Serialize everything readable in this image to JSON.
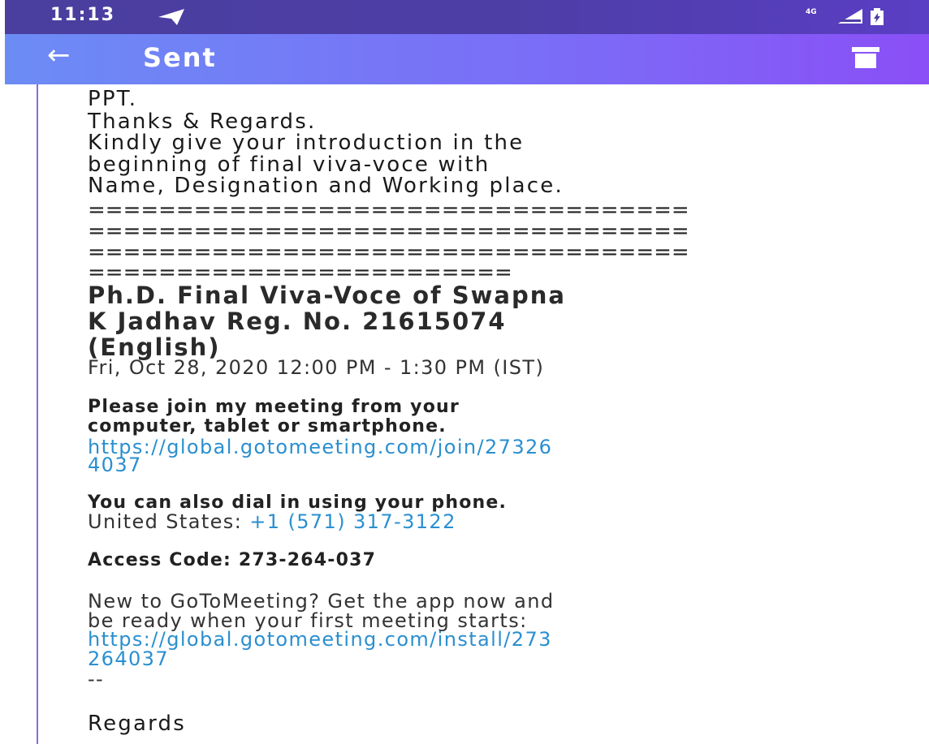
{
  "status_bar": {
    "time": "11:13",
    "network": "4G",
    "icons": [
      "telegram-send-icon",
      "signal-icon",
      "battery-icon"
    ]
  },
  "app_bar": {
    "title": "Sent",
    "icons": [
      "back-arrow-icon",
      "delete-icon"
    ]
  },
  "message": {
    "lines": [
      "PPT.",
      "Thanks & Regards.",
      "Kindly give your introduction in the",
      "beginning of final viva-voce with",
      "Name, Designation and Working place."
    ],
    "separators": [
      "==================================",
      "==================================",
      "==================================",
      "========================"
    ],
    "meeting_title_lines": [
      "Ph.D. Final Viva-Voce of Swapna",
      "K Jadhav Reg. No. 21615074",
      "(English)"
    ],
    "meeting_time": "Fri, Oct 28, 2020 12:00 PM - 1:30 PM (IST)",
    "join_prompt_lines": [
      "Please join my meeting from your",
      "computer, tablet or smartphone."
    ],
    "join_link_lines": [
      "https://global.gotomeeting.com/join/27326",
      "4037"
    ],
    "dial_prompt": "You can also dial in using your phone.",
    "dial_country": "United States: ",
    "dial_number": "+1 (571) 317-3122",
    "access_code": "Access Code: 273-264-037",
    "new_user_lines": [
      "New to GoToMeeting? Get the app now and",
      "be ready when your first meeting starts:"
    ],
    "install_link_lines": [
      "https://global.gotomeeting.com/install/273",
      "264037"
    ],
    "signature_dash": "--",
    "regards": "Regards"
  },
  "colors": {
    "status_bar": "#4d3ea6",
    "app_bar_start": "#6c8cf5",
    "app_bar_end": "#8a4ff6",
    "link": "#2a8fd0",
    "left_rule": "#8c6adf"
  }
}
